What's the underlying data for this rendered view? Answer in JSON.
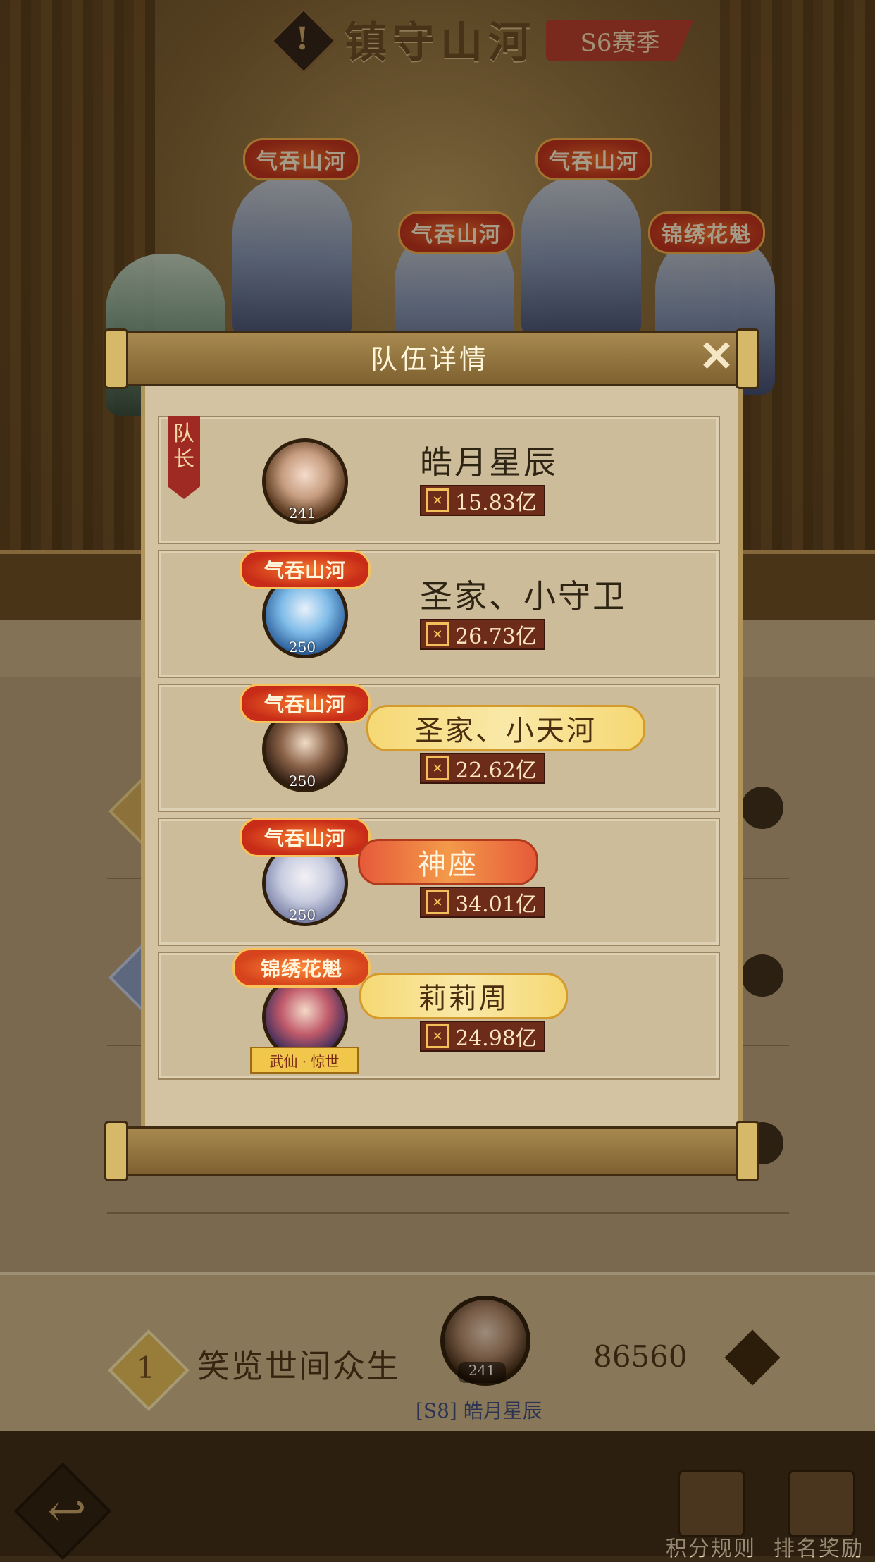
{
  "header": {
    "title": "镇守山河",
    "season": "S6赛季"
  },
  "scene": {
    "hero_titles": [
      "气吞山河",
      "气吞山河",
      "气吞山河",
      "锦绣花魁"
    ]
  },
  "self_row": {
    "rank": "1",
    "guild_name": "笑览世间众生",
    "avatar_level": "241",
    "score": "86560",
    "player_tag": "[S8] 皓月星辰"
  },
  "footer": {
    "rules_label": "积分规则",
    "rewards_label": "排名奖励"
  },
  "modal": {
    "title": "队伍详情",
    "close_label": "✕",
    "captain_label": "队长",
    "members": [
      {
        "name": "皓月星辰",
        "level": "241",
        "power": "15.83亿",
        "title_tag": "",
        "banner": ""
      },
      {
        "name": "圣家、小守卫",
        "level": "250",
        "power": "26.73亿",
        "title_tag": "气吞山河",
        "banner": ""
      },
      {
        "name": "圣家、小天河",
        "level": "250",
        "power": "22.62亿",
        "title_tag": "气吞山河",
        "banner": "gold"
      },
      {
        "name": "神座",
        "level": "250",
        "power": "34.01亿",
        "title_tag": "气吞山河",
        "banner": "red"
      },
      {
        "name": "莉莉周",
        "level": "",
        "power": "24.98亿",
        "title_tag": "锦绣花魁",
        "banner": "gold",
        "sub_tag": "武仙 · 惊世"
      }
    ]
  },
  "colors": {
    "accent_red": "#9f2a24",
    "gold": "#d6b869",
    "panel": "#d3c3a2"
  }
}
